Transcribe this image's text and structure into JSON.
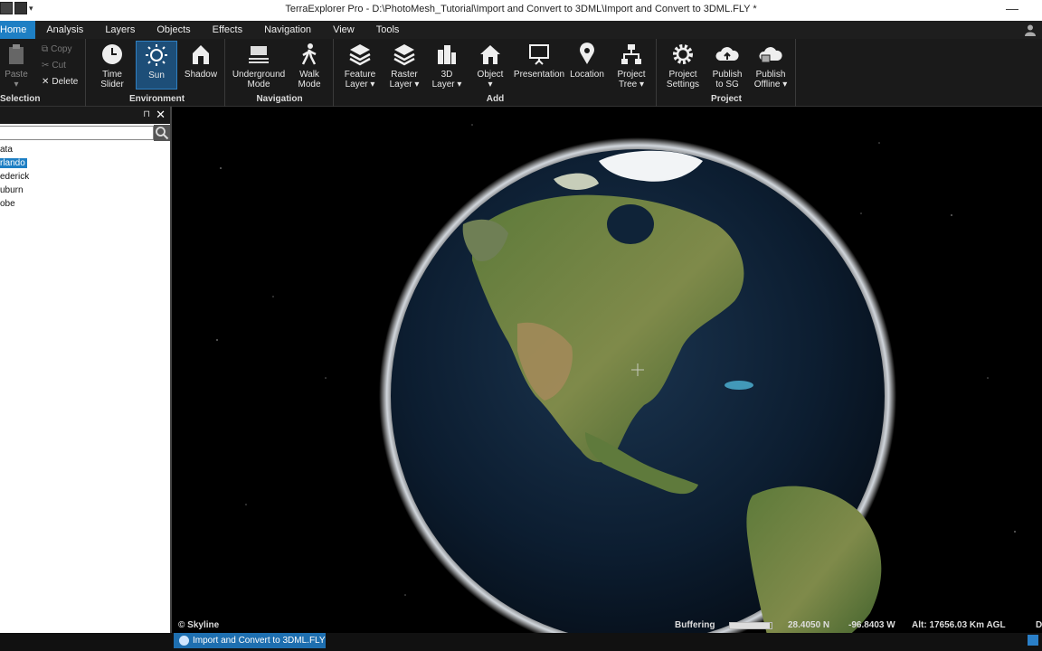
{
  "window": {
    "title": "TerraExplorer Pro - D:\\PhotoMesh_Tutorial\\Import and Convert to 3DML\\Import and Convert to 3DML.FLY *",
    "minimize": "—"
  },
  "tabs": [
    "Home",
    "Analysis",
    "Layers",
    "Objects",
    "Effects",
    "Navigation",
    "View",
    "Tools"
  ],
  "ribbon": {
    "selection": {
      "label": "Selection",
      "paste": "Paste",
      "copy": "Copy",
      "cut": "Cut",
      "delete": "Delete"
    },
    "environment": {
      "label": "Environment",
      "time_slider": [
        "Time",
        "Slider"
      ],
      "sun": "Sun",
      "shadow": "Shadow"
    },
    "navigation": {
      "label": "Navigation",
      "underground": [
        "Underground",
        "Mode"
      ],
      "walk": [
        "Walk",
        "Mode"
      ]
    },
    "add": {
      "label": "Add",
      "feature_layer": [
        "Feature",
        "Layer ▾"
      ],
      "raster_layer": [
        "Raster",
        "Layer ▾"
      ],
      "layer_3d": [
        "3D",
        "Layer ▾"
      ],
      "object": [
        "Object",
        "▾"
      ],
      "presentation": "Presentation",
      "location": "Location",
      "project_tree": [
        "Project",
        "Tree ▾"
      ]
    },
    "project": {
      "label": "Project",
      "settings": [
        "Project",
        "Settings"
      ],
      "publish_sg": [
        "Publish",
        "to SG"
      ],
      "publish_offline": [
        "Publish",
        "Offline ▾"
      ]
    }
  },
  "panel": {
    "pin": "⊓",
    "close": "✕",
    "search_placeholder": "",
    "items": [
      "ata",
      "rlando",
      "ederick",
      "uburn",
      "obe"
    ],
    "selected_index": 1
  },
  "viewer": {
    "copyright": "© Skyline",
    "buffering_label": "Buffering",
    "buffering_progress": 0.95,
    "latitude": "28.4050 N",
    "longitude": "-96.8403 W",
    "altitude": "Alt: 17656.03 Km AGL",
    "right_flag": "D"
  },
  "doc_tabs": [
    "Import and Convert to 3DML.FLY"
  ],
  "colors": {
    "accent": "#1e7fc4",
    "ribbon_bg": "#1a1a1a",
    "panel_bg": "#ffffff",
    "space": "#000000"
  }
}
